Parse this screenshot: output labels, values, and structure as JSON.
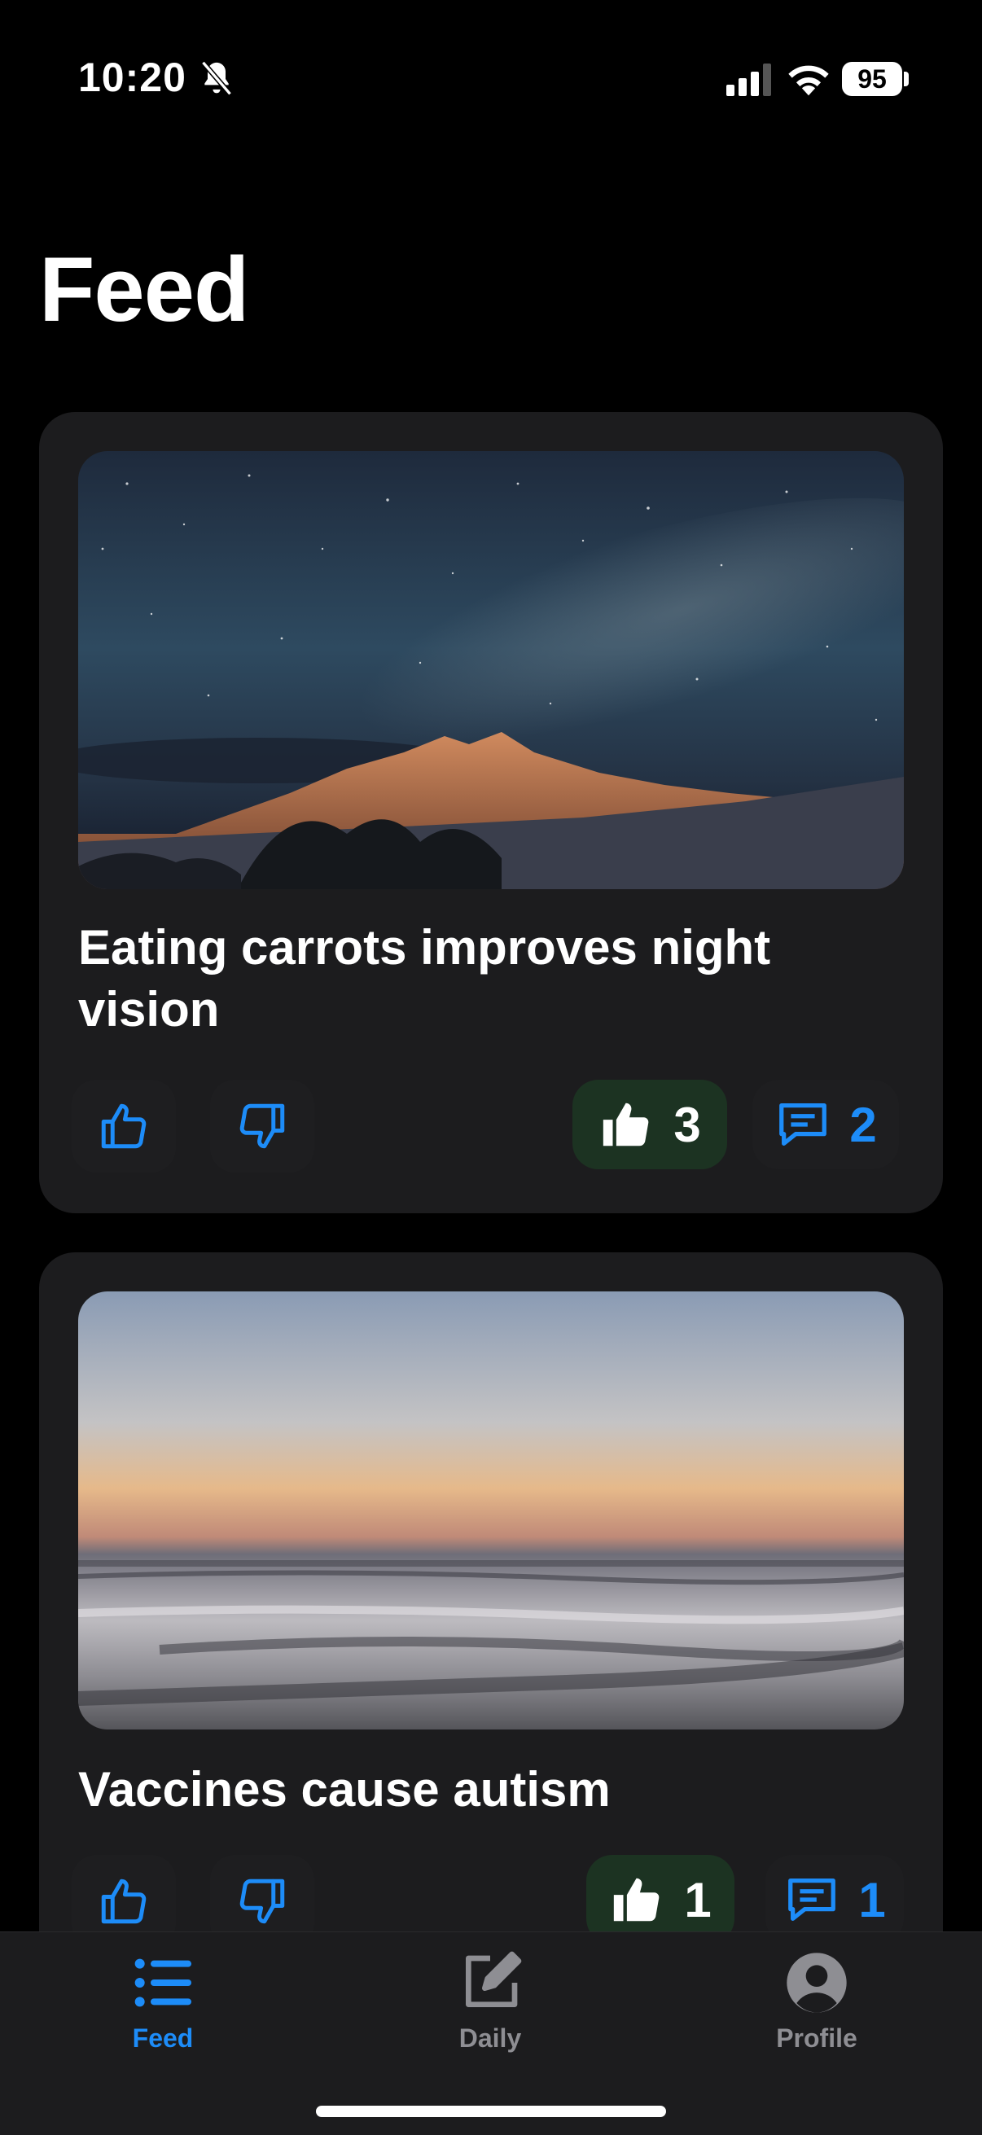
{
  "status_bar": {
    "time": "10:20",
    "battery": "95",
    "icons": [
      "bell-slash-icon",
      "cellular-signal-icon",
      "wifi-icon",
      "battery-icon"
    ]
  },
  "page_title": "Feed",
  "colors": {
    "accent": "#1d8cf8",
    "background": "#000000",
    "card": "#1c1c1e",
    "like_pill": "#1c3322"
  },
  "posts": [
    {
      "title": "Eating carrots improves night vision",
      "image": "night-sky-mountain",
      "likes": "3",
      "comments": "2"
    },
    {
      "title": "Vaccines cause autism",
      "image": "sunset-beach",
      "likes": "1",
      "comments": "1"
    }
  ],
  "tab_bar": {
    "tabs": [
      {
        "label": "Feed",
        "icon": "list-icon",
        "active": true
      },
      {
        "label": "Daily",
        "icon": "compose-icon",
        "active": false
      },
      {
        "label": "Profile",
        "icon": "person-circle-icon",
        "active": false
      }
    ]
  }
}
